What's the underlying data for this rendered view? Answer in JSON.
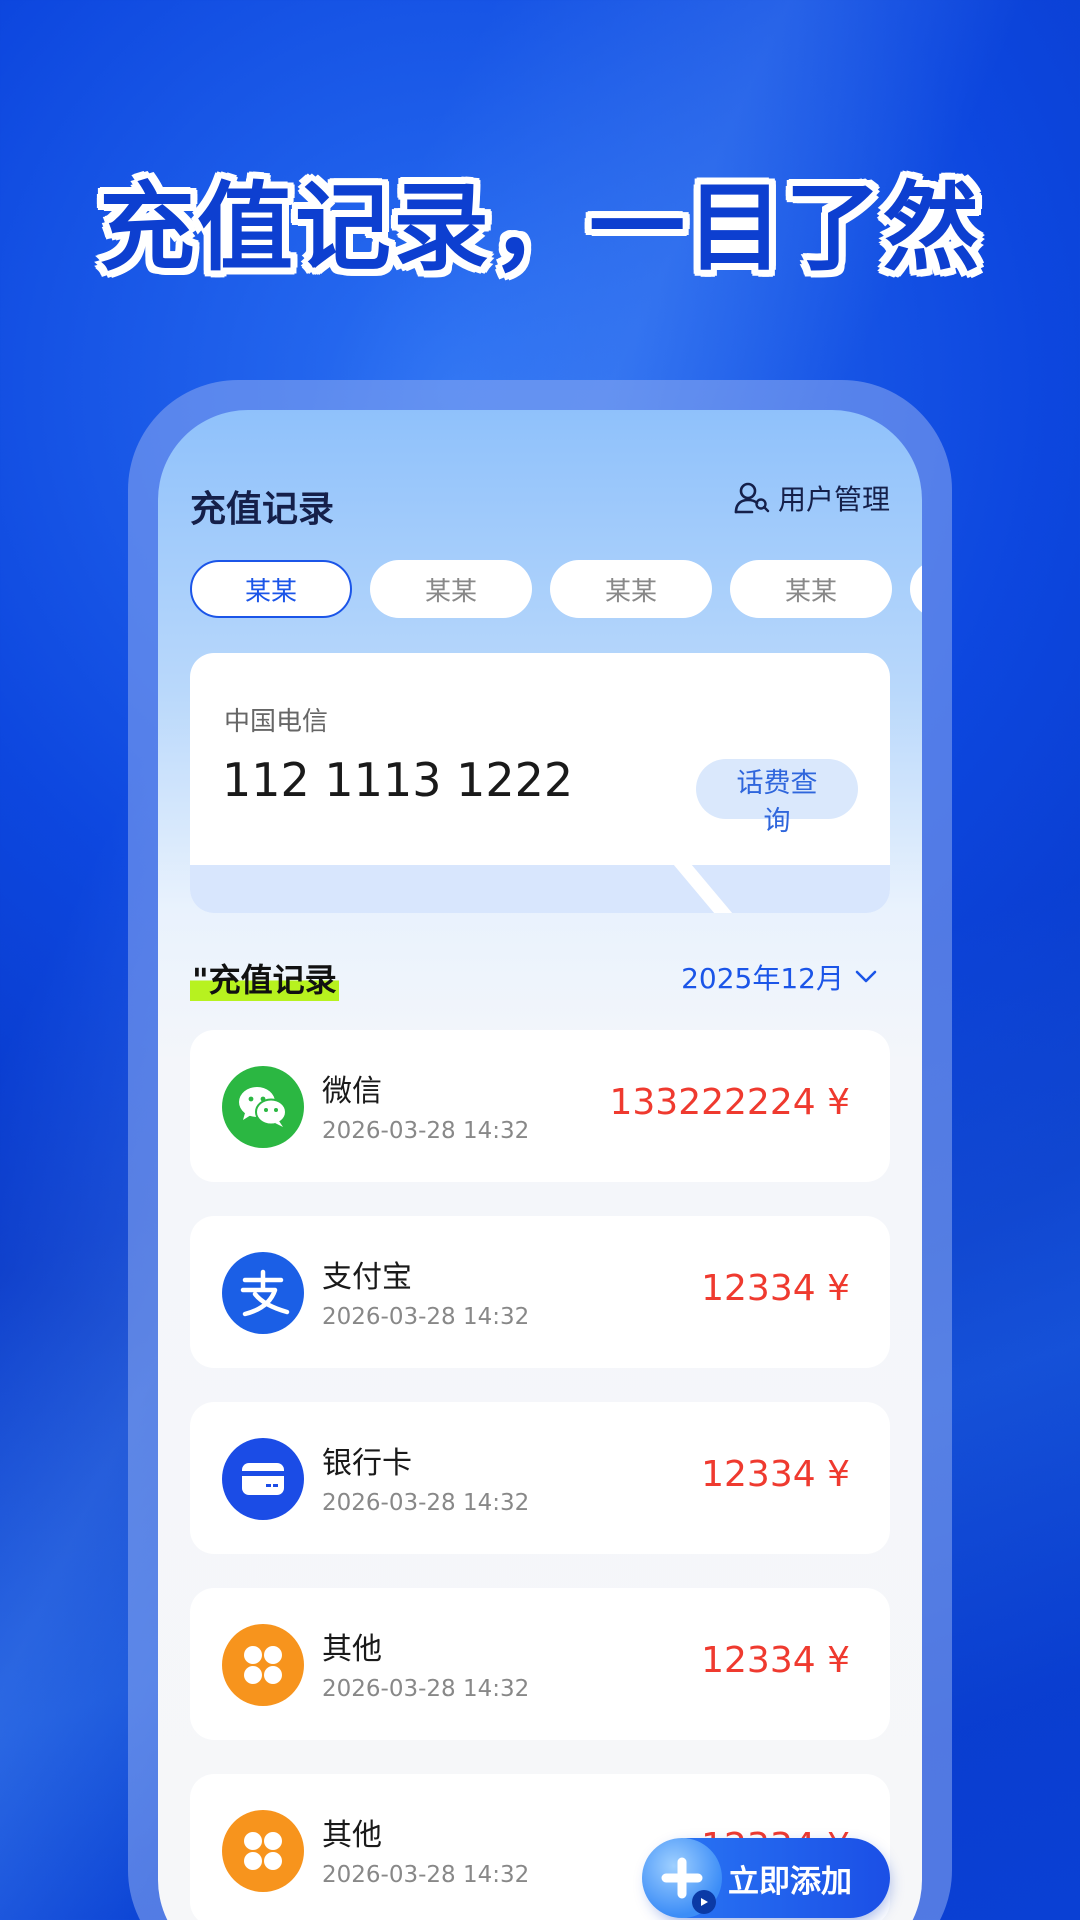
{
  "headline": "充值记录，一目了然",
  "header": {
    "title": "充值记录",
    "user_mgmt_label": "用户管理"
  },
  "tabs": [
    {
      "label": "某某",
      "active": true
    },
    {
      "label": "某某",
      "active": false
    },
    {
      "label": "某某",
      "active": false
    },
    {
      "label": "某某",
      "active": false
    }
  ],
  "card": {
    "carrier": "中国电信",
    "phone_number": "112 1113 1222",
    "fee_query_label": "话费查询"
  },
  "section": {
    "title": "\"充值记录",
    "month": "2025年12月"
  },
  "records": [
    {
      "name": "微信",
      "time": "2026-03-28 14:32",
      "amount": "133222224 ¥",
      "icon": "wechat-icon",
      "color": "#2bb742"
    },
    {
      "name": "支付宝",
      "time": "2026-03-28 14:32",
      "amount": "12334 ¥",
      "icon": "alipay-icon",
      "color": "#1b5fe6"
    },
    {
      "name": "银行卡",
      "time": "2026-03-28 14:32",
      "amount": "12334 ¥",
      "icon": "bank-card-icon",
      "color": "#1b4ce6"
    },
    {
      "name": "其他",
      "time": "2026-03-28 14:32",
      "amount": "12334 ¥",
      "icon": "grid-icon",
      "color": "#f7941d"
    },
    {
      "name": "其他",
      "time": "2026-03-28 14:32",
      "amount": "12334 ¥",
      "icon": "grid-icon",
      "color": "#f7941d"
    }
  ],
  "add_button": {
    "label": "立即添加"
  },
  "colors": {
    "accent": "#1b55e8",
    "amount": "#ef3a2f",
    "highlight": "#b7f21f"
  }
}
